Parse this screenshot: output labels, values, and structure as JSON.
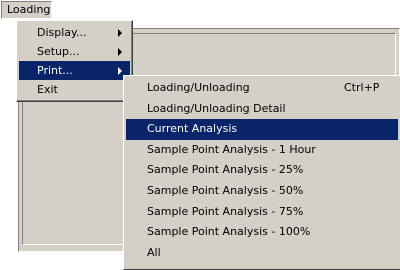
{
  "menubar": {
    "items": [
      {
        "label": "Loading"
      }
    ]
  },
  "menu": {
    "items": [
      {
        "label": "Display...",
        "submenu": true
      },
      {
        "label": "Setup...",
        "submenu": true
      },
      {
        "label": "Print...",
        "submenu": true,
        "selected": true
      },
      {
        "label": "Exit",
        "submenu": false
      }
    ]
  },
  "submenu": {
    "items": [
      {
        "label": "Loading/Unloading",
        "shortcut": "Ctrl+P"
      },
      {
        "label": "Loading/Unloading Detail"
      },
      {
        "label": "Current Analysis",
        "selected": true
      },
      {
        "label": "Sample Point Analysis - 1 Hour"
      },
      {
        "label": "Sample Point Analysis - 25%"
      },
      {
        "label": "Sample Point Analysis - 50%"
      },
      {
        "label": "Sample Point Analysis - 75%"
      },
      {
        "label": "Sample Point Analysis - 100%"
      },
      {
        "label": "All"
      }
    ]
  },
  "colors": {
    "menu_bg": "#d4d0c8",
    "highlight": "#0a246a",
    "highlight_text": "#ffffff"
  },
  "icons": {
    "submenu_arrow": "chevron-right-icon"
  }
}
